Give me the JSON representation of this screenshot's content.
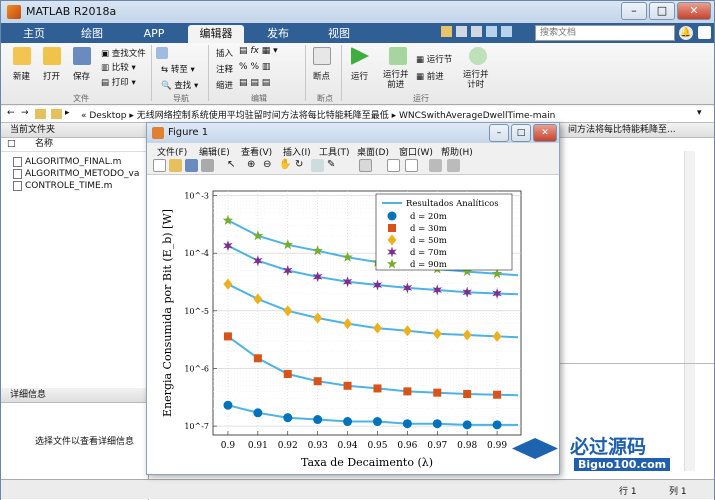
{
  "window": {
    "title": "MATLAB R2018a",
    "search_placeholder": "搜索文档"
  },
  "tabs": [
    "主页",
    "绘图",
    "APP",
    "编辑器",
    "发布",
    "视图"
  ],
  "active_tab": "编辑器",
  "ribbon": {
    "file_group": {
      "label": "文件",
      "new": "新建",
      "open": "打开",
      "save": "保存",
      "find_file": "查找文件",
      "compare": "比较",
      "print": "打印"
    },
    "nav_group": {
      "label": "导航",
      "goto": "转至",
      "find": "查找"
    },
    "edit_group": {
      "label": "编辑",
      "insert": "插入",
      "comment": "注释",
      "indent": "缩进"
    },
    "breakpoint_group": {
      "label": "断点",
      "breakpoint": "断点"
    },
    "run_group": {
      "label": "运行",
      "run": "运行",
      "run_advance": "运行并\n前进",
      "run_section": "运行节",
      "advance": "前进",
      "run_time": "运行并\n计时"
    }
  },
  "address": {
    "path": [
      "Desktop",
      "无线网络控制系统使用平均驻留时间方法将每比特能耗降至最低",
      "WNCSwithAverageDwellTime-main"
    ]
  },
  "left_panel": {
    "title": "当前文件夹",
    "column": "名称",
    "files": [
      "ALGORITMO_FINAL.m",
      "ALGORITMO_METODO_va",
      "CONTROLE_TIME.m"
    ],
    "details_title": "详细信息",
    "details_text": "选择文件以查看详细信息"
  },
  "right_peek": "间方法将每比特能耗降至...",
  "status": {
    "line_label": "行",
    "line_value": "1",
    "col_label": "列",
    "col_value": "1"
  },
  "figure": {
    "title": "Figure 1",
    "menu": [
      "文件(F)",
      "编辑(E)",
      "查看(V)",
      "插入(I)",
      "工具(T)",
      "桌面(D)",
      "窗口(W)",
      "帮助(H)"
    ]
  },
  "watermark": {
    "text": "必过源码",
    "sub": "Biguo100.com"
  },
  "colors": {
    "tab_bar": "#2f5f95",
    "curve": "#4db3e6"
  },
  "chart_data": {
    "type": "scatter",
    "xlabel": "Taxa de Decaimento (λ)",
    "ylabel": "Energia Consumida por Bit (E_b) [W]",
    "xscale": "linear",
    "yscale": "log",
    "xlim": [
      0.895,
      0.998
    ],
    "ylim": [
      7e-08,
      0.0012
    ],
    "xticks": [
      "0.9",
      "0.91",
      "0.92",
      "0.93",
      "0.94",
      "0.95",
      "0.96",
      "0.97",
      "0.98",
      "0.99"
    ],
    "yticks": [
      "10^-7",
      "10^-6",
      "10^-5",
      "10^-4",
      "10^-3"
    ],
    "grid": true,
    "legend_position": "top-right",
    "curve_label": "Resultados Analíticos",
    "x": [
      0.9,
      0.91,
      0.92,
      0.93,
      0.94,
      0.95,
      0.96,
      0.97,
      0.98,
      0.99
    ],
    "series": [
      {
        "name": "d = 20m",
        "marker": "circle",
        "color": "#0072bd",
        "values": [
          2.3e-07,
          1.7e-07,
          1.4e-07,
          1.3e-07,
          1.2e-07,
          1.2e-07,
          1.1e-07,
          1.1e-07,
          1.05e-07,
          1.05e-07
        ]
      },
      {
        "name": "d = 30m",
        "marker": "square",
        "color": "#d95319",
        "values": [
          3.6e-06,
          1.5e-06,
          8e-07,
          6e-07,
          5e-07,
          4.5e-07,
          4e-07,
          3.8e-07,
          3.6e-07,
          3.5e-07
        ]
      },
      {
        "name": "d = 50m",
        "marker": "diamond",
        "color": "#edb120",
        "values": [
          2.9e-05,
          1.6e-05,
          1e-05,
          7.5e-06,
          6e-06,
          5e-06,
          4.5e-06,
          4e-06,
          3.8e-06,
          3.6e-06
        ]
      },
      {
        "name": "d = 70m",
        "marker": "hexagram",
        "color": "#7e2f8e",
        "values": [
          0.000135,
          7.4e-05,
          5e-05,
          3.9e-05,
          3.2e-05,
          2.8e-05,
          2.5e-05,
          2.3e-05,
          2.1e-05,
          2e-05
        ]
      },
      {
        "name": "d = 90m",
        "marker": "pentagram",
        "color": "#77ac30",
        "values": [
          0.00037,
          0.0002,
          0.00014,
          0.00011,
          8.5e-05,
          7e-05,
          6e-05,
          5.3e-05,
          4.8e-05,
          4.4e-05
        ]
      }
    ]
  }
}
